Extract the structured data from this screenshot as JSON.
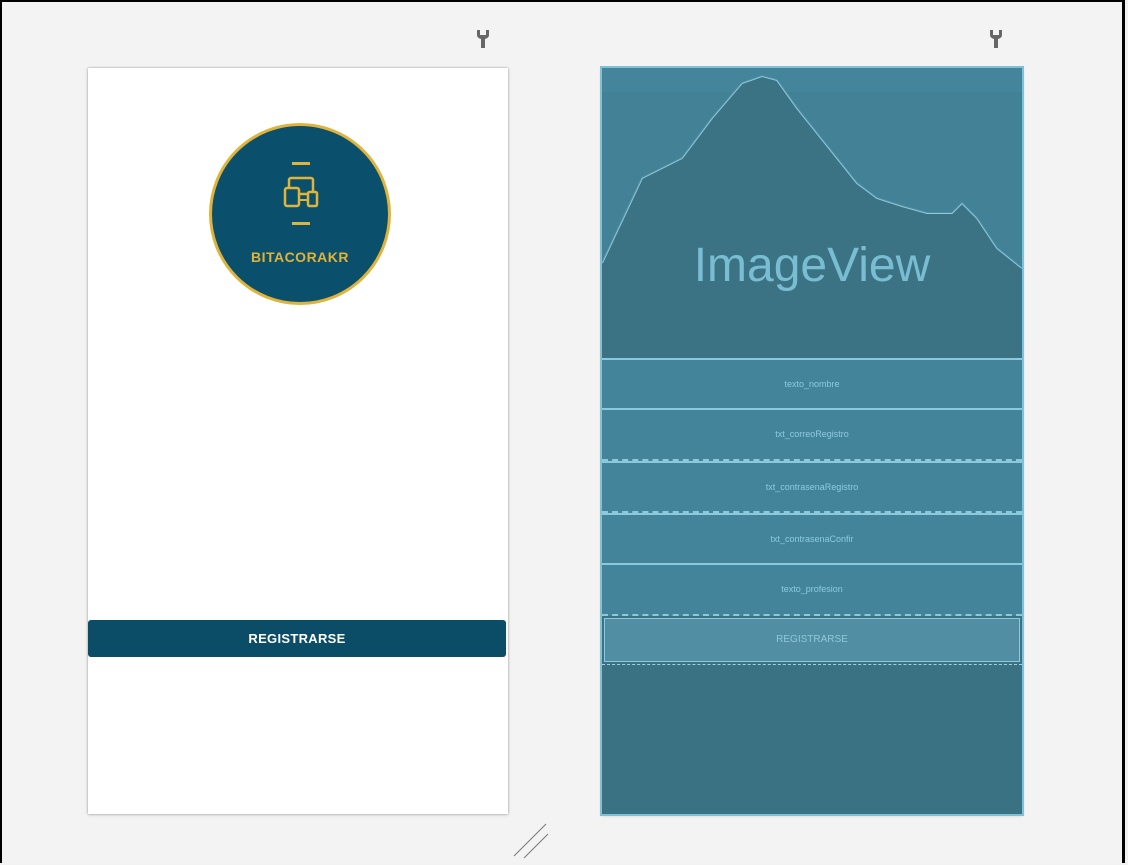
{
  "design_view": {
    "logo_text": "BITACORAKR",
    "register_button_label": "REGISTRARSE",
    "colors": {
      "primary": "#0a4f6b",
      "accent": "#e0b33a"
    }
  },
  "blueprint_view": {
    "image_placeholder_label": "ImageView",
    "fields": [
      {
        "id": "texto_nombre"
      },
      {
        "id": "txt_correoRegistro"
      },
      {
        "id": "txt_contrasenaRegistro"
      },
      {
        "id": "txt_contrasenaConfir"
      },
      {
        "id": "texto_profesion"
      }
    ],
    "button_label": "REGISTRARSE",
    "colors": {
      "background": "#3a7283",
      "outline": "#8cc9dd"
    }
  },
  "icons": {
    "toolbar_left": "wrench-icon",
    "toolbar_right": "wrench-icon",
    "resize": "resize-handle-icon"
  }
}
